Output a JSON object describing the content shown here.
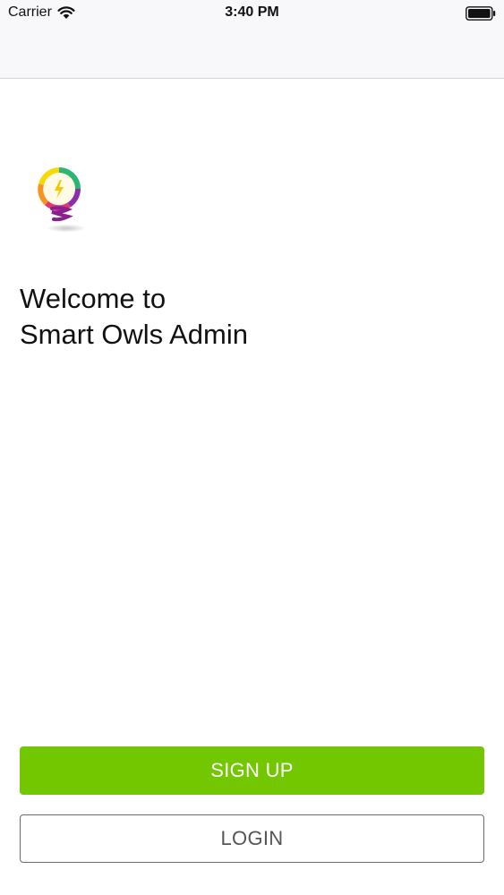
{
  "status_bar": {
    "carrier": "Carrier",
    "time": "3:40 PM",
    "wifi_icon": "wifi-icon",
    "battery_icon": "battery-icon"
  },
  "logo": {
    "icon": "lightbulb-logo-icon"
  },
  "welcome": {
    "line1": "Welcome to",
    "line2": "Smart Owls Admin"
  },
  "actions": {
    "signup_label": "SIGN UP",
    "login_label": "LOGIN"
  },
  "colors": {
    "signup_button": "#72c700",
    "login_border": "#6a6a6a",
    "bar_background": "#f8f7f9"
  }
}
